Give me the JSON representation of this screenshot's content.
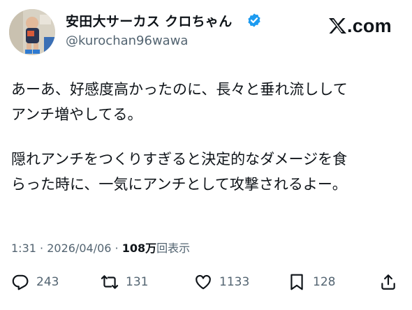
{
  "tweet": {
    "display_name": "安田大サーカス クロちゃん",
    "handle": "@kurochan96wawa",
    "lines_paragraph1": [
      "あーあ、好感度高かったのに、長々と垂れ流しして",
      "アンチ増やしてる。"
    ],
    "lines_paragraph2": [
      "隠れアンチをつくりすぎると決定的なダメージを食",
      "らった時に、一気にアンチとして攻撃されるよー。"
    ],
    "time": "1:31",
    "separator": "·",
    "date": "2026/04/06",
    "views_count": "108万",
    "views_label": "回表示"
  },
  "brand": {
    "x_com": ".com"
  },
  "actions": {
    "reply_count": "243",
    "repost_count": "131",
    "like_count": "1133",
    "bookmark_count": "128"
  },
  "colors": {
    "text": "#0f1419",
    "secondary": "#536471",
    "verified": "#1d9bf0"
  },
  "icons": [
    "verified-badge-icon",
    "x-logo-icon",
    "reply-icon",
    "repost-icon",
    "like-icon",
    "bookmark-icon",
    "share-icon"
  ]
}
